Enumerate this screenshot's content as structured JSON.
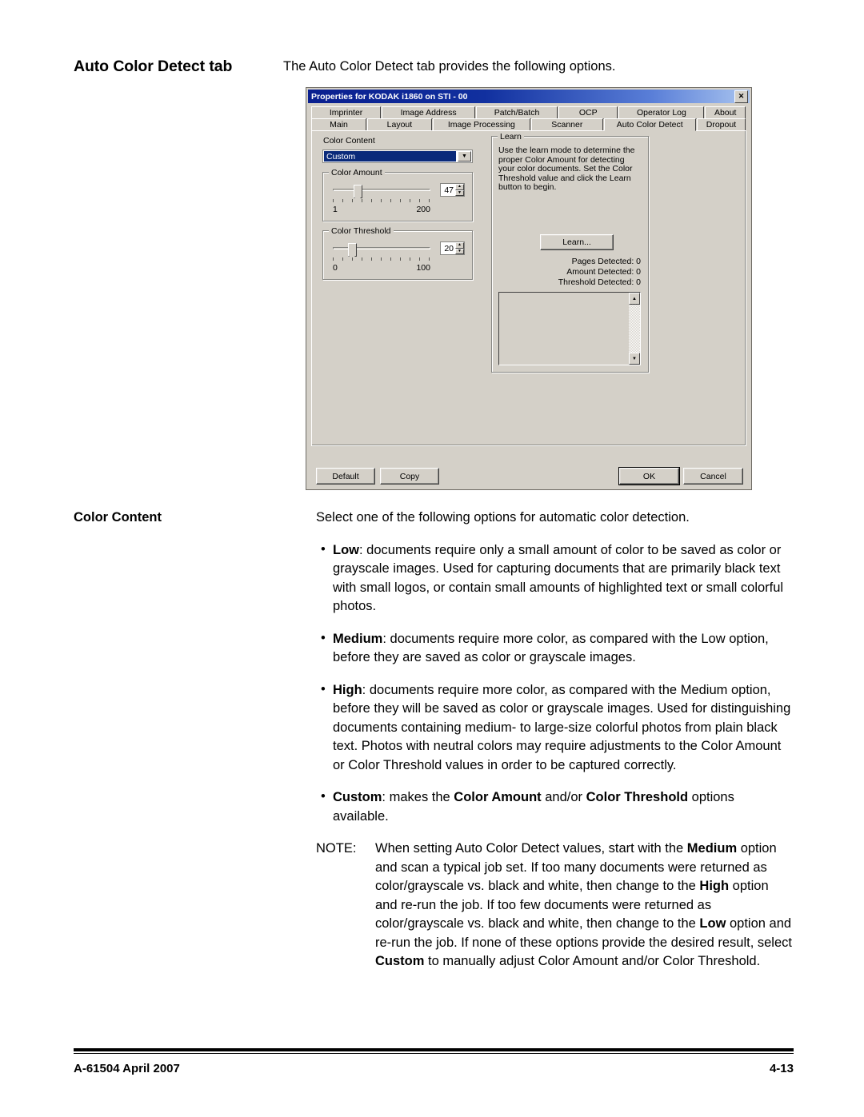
{
  "header": {
    "term": "Auto Color Detect tab",
    "intro": "The Auto Color Detect tab provides the following options."
  },
  "dialog": {
    "title": "Properties for KODAK i1860 on STI - 00",
    "close_icon": "✕",
    "tabs_row1": [
      "Imprinter",
      "Image Address",
      "Patch/Batch",
      "OCP",
      "Operator Log",
      "About"
    ],
    "tabs_row2": [
      "Main",
      "Layout",
      "Image Processing",
      "Scanner",
      "Auto Color Detect",
      "Dropout"
    ],
    "active_tab": "Auto Color Detect",
    "color_content": {
      "label": "Color Content",
      "value": "Custom",
      "arrow_icon": "▼"
    },
    "color_amount": {
      "label": "Color Amount",
      "value": "47",
      "min_label": "1",
      "max_label": "200",
      "min": 1,
      "max": 200,
      "thumb_pct": 25,
      "up_icon": "▲",
      "down_icon": "▼"
    },
    "color_threshold": {
      "label": "Color Threshold",
      "value": "20",
      "min_label": "0",
      "max_label": "100",
      "min": 0,
      "max": 100,
      "thumb_pct": 20,
      "up_icon": "▲",
      "down_icon": "▼"
    },
    "learn": {
      "label": "Learn",
      "description": "Use the learn mode to determine the proper Color Amount for detecting your color documents. Set the Color Threshold value and click the Learn button to begin.",
      "button": "Learn...",
      "pages_detected": "Pages Detected:  0",
      "amount_detected": "Amount Detected:  0",
      "threshold_detected": "Threshold Detected:  0",
      "scroll_up_icon": "▲",
      "scroll_down_icon": "▼"
    },
    "buttons": {
      "default": "Default",
      "copy": "Copy",
      "ok": "OK",
      "cancel": "Cancel"
    }
  },
  "content": {
    "term": "Color Content",
    "intro": "Select one of the following options for automatic color detection.",
    "bullet_char": "•",
    "bullets": [
      {
        "term": "Low",
        "text": ": documents require only a small amount of color to be saved as color or grayscale images. Used for capturing documents that are primarily black text with small logos, or contain small amounts of highlighted text or small colorful photos."
      },
      {
        "term": "Medium",
        "text": ": documents require more color, as compared with the Low option, before they are saved as color or grayscale images."
      },
      {
        "term": "High",
        "text": ": documents require more color, as compared with the Medium option, before they will be saved as color or grayscale images. Used for distinguishing documents containing medium- to large-size colorful photos from plain black text. Photos with neutral colors may require adjustments to the Color Amount or Color Threshold values in order to be captured correctly."
      }
    ],
    "custom_bullet": {
      "term": "Custom",
      "part1": ": makes the ",
      "bold1": "Color Amount",
      "part2": " and/or ",
      "bold2": "Color Threshold",
      "part3": " options available."
    },
    "note": {
      "label": "NOTE:",
      "p1": "When setting Auto Color Detect values, start with the ",
      "b1": "Medium",
      "p2": " option and scan a typical job set. If too many documents were returned as color/grayscale vs. black and white, then change to the ",
      "b2": "High",
      "p3": " option and re-run the job. If too few documents were returned as color/grayscale vs. black and white, then change to the ",
      "b3": "Low",
      "p4": " option and re-run the job. If none of these options provide the desired result, select ",
      "b4": "Custom",
      "p5": " to manually adjust Color Amount and/or Color Threshold."
    }
  },
  "footer": {
    "left": "A-61504  April 2007",
    "right": "4-13"
  }
}
